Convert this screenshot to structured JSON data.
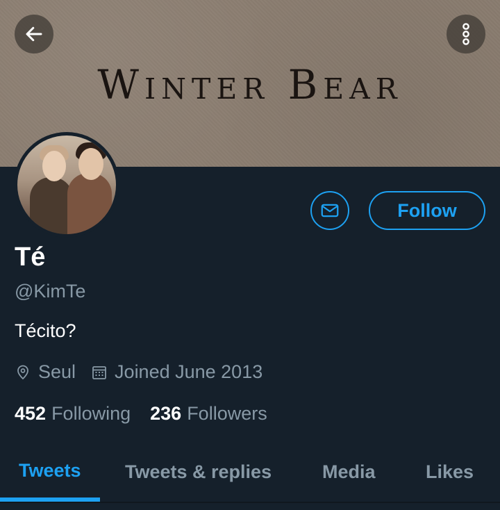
{
  "banner": {
    "text": "Winter Bear"
  },
  "header": {
    "back_icon": "arrow-left-icon",
    "more_icon": "more-vertical-icon"
  },
  "profile": {
    "name": "Té",
    "handle": "@KimTe",
    "bio": "Técito?",
    "location": "Seul",
    "joined": "Joined June 2013",
    "following_count": "452",
    "following_label": "Following",
    "followers_count": "236",
    "followers_label": "Followers"
  },
  "actions": {
    "message_icon": "mail-icon",
    "follow_label": "Follow"
  },
  "tabs": [
    {
      "label": "Tweets",
      "active": true
    },
    {
      "label": "Tweets & replies",
      "active": false
    },
    {
      "label": "Media",
      "active": false
    },
    {
      "label": "Likes",
      "active": false
    }
  ],
  "colors": {
    "accent": "#1da1f2",
    "background": "#15202b",
    "muted": "#8899a6",
    "banner": "#8b7d70"
  }
}
